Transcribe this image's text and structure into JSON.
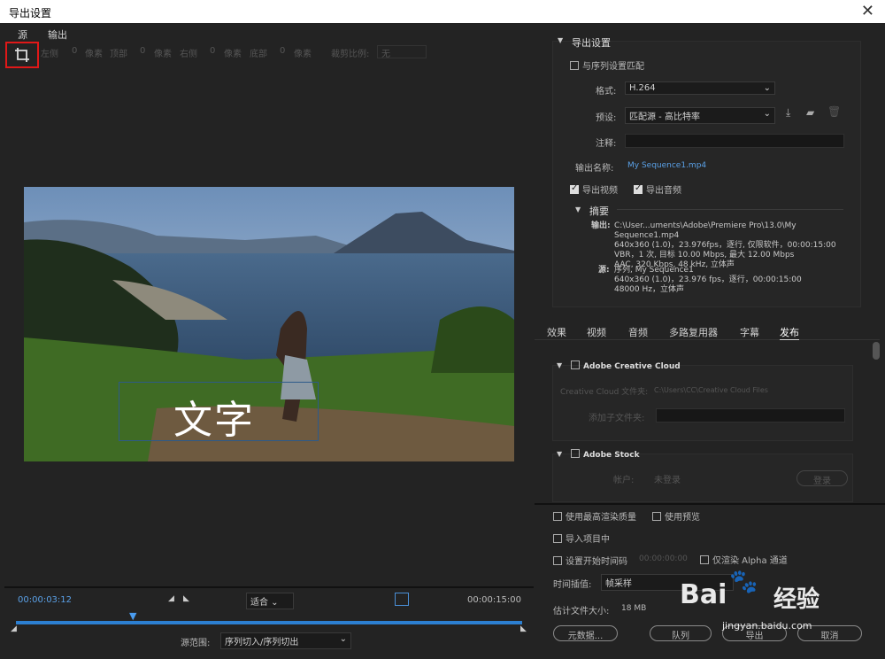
{
  "window": {
    "title": "导出设置",
    "close": "✕"
  },
  "left": {
    "tabs": [
      "源",
      "输出"
    ],
    "crop": {
      "left_label": "左侧",
      "left_val": "0",
      "px1": "像素",
      "top_label": "顶部",
      "top_val": "0",
      "px2": "像素",
      "right_label": "右侧",
      "right_val": "0",
      "px3": "像素",
      "bottom_label": "底部",
      "bottom_val": "0",
      "px4": "像素",
      "ratio_label": "裁剪比例:",
      "ratio_val": "无"
    },
    "overlay_text": "文字",
    "timeline": {
      "current": "00:00:03:12",
      "fit": "适合",
      "end": "00:00:15:00",
      "range_label": "源范围:",
      "range_val": "序列切入/序列切出"
    }
  },
  "right": {
    "export_settings": {
      "header": "导出设置",
      "match_seq": "与序列设置匹配",
      "format_label": "格式:",
      "format_val": "H.264",
      "preset_label": "预设:",
      "preset_val": "匹配源 - 高比特率",
      "comment_label": "注释:",
      "outname_label": "输出名称:",
      "outname_val": "My Sequence1.mp4",
      "export_video": "导出视频",
      "export_audio": "导出音频"
    },
    "summary": {
      "header": "摘要",
      "out_label": "输出:",
      "out_lines": [
        "C:\\User...uments\\Adobe\\Premiere Pro\\13.0\\My Sequence1.mp4",
        "640x360 (1.0)，23.976fps，逐行, 仅限软件，00:00:15:00",
        "VBR，1 次, 目标 10.00 Mbps, 最大 12.00 Mbps",
        "AAC, 320 Kbps, 48  kHz, 立体声"
      ],
      "src_label": "源:",
      "src_lines": [
        "序列, My Sequence1",
        "640x360 (1.0)，23.976 fps，逐行，00:00:15:00",
        "48000 Hz，立体声"
      ]
    },
    "tabs": [
      "效果",
      "视频",
      "音频",
      "多路复用器",
      "字幕",
      "发布"
    ],
    "publish": {
      "cc_header": "Adobe Creative Cloud",
      "cc_folder_label": "Creative Cloud 文件夹:",
      "cc_folder_val": "C:\\Users\\CC\\Creative Cloud Files",
      "subfolder_label": "添加子文件夹:",
      "stock_header": "Adobe Stock",
      "account_label": "帐户:",
      "account_val": "未登录",
      "login_btn": "登录"
    },
    "bottom": {
      "max_quality": "使用最高渲染质量",
      "use_preview": "使用预览",
      "import": "导入项目中",
      "set_start": "设置开始时间码",
      "start_tc": "00:00:00:00",
      "alpha_only": "仅渲染 Alpha 通道",
      "interp_label": "时间插值:",
      "interp_val": "帧采样",
      "filesize_label": "估计文件大小:",
      "filesize_val": "18 MB",
      "metadata_btn": "元数据...",
      "queue_btn": "队列",
      "export_btn": "导出",
      "cancel_btn": "取消"
    }
  },
  "watermark": {
    "brand": "Bai",
    "brand2": "经验",
    "url": "jingyan.baidu.com"
  }
}
